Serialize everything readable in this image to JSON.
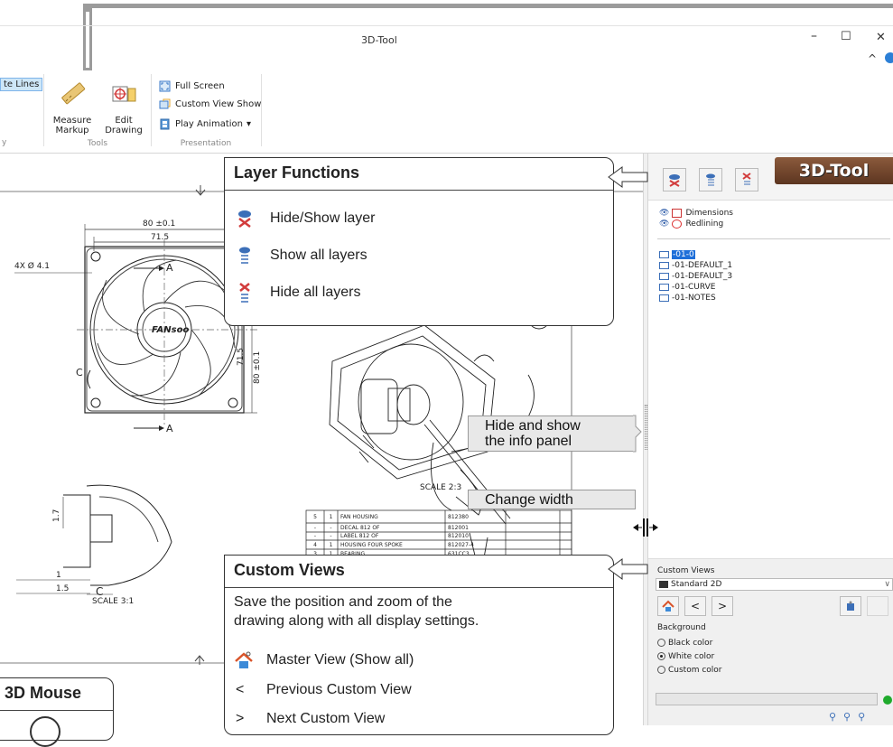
{
  "window": {
    "title": "3D-Tool",
    "minimize": "–",
    "maximize": "☐",
    "close": "✕",
    "collapse": "^"
  },
  "ribbon": {
    "delete_lines": "te Lines",
    "measure_line1": "Measure",
    "measure_line2": "Markup",
    "edit_line1": "Edit",
    "edit_line2": "Drawing",
    "tools_label": "Tools",
    "full_screen": "Full Screen",
    "custom_view_show": "Custom View Show",
    "play_animation": "Play Animation",
    "presentation_label": "Presentation",
    "left_group_fragment": "y"
  },
  "callouts": {
    "layer": {
      "title": "Layer Functions",
      "items": [
        "Hide/Show layer",
        "Show all layers",
        "Hide all layers"
      ]
    },
    "info_panel": "Hide and show the info panel",
    "info_panel_line1": "Hide and show",
    "info_panel_line2": "the info panel",
    "change_width": "Change width",
    "custom_views": {
      "title": "Custom Views",
      "desc_line1": "Save the position and zoom of the",
      "desc_line2": "drawing along with all display settings.",
      "items": [
        "Master View (Show all)",
        "Previous Custom View",
        "Next Custom View"
      ],
      "prefixes": [
        "<",
        ">"
      ]
    },
    "mouse": "3D Mouse"
  },
  "drawing": {
    "dim_80": "80 ±0.1",
    "dim_715": "71.5",
    "holes": "4X Ø 4.1",
    "section_a": "A",
    "side_715": "71.5",
    "side_80": "80 ±0.1",
    "section_c": "C",
    "scale_23": "SCALE 2:3",
    "scale_31": "SCALE 3:1",
    "dim_15": "1.5",
    "dim_1": "1",
    "dim_17": "1.7",
    "brand": "FANsoo",
    "bom": [
      [
        "5",
        "1",
        "FAN HOUSING",
        "812380"
      ],
      [
        "-",
        "-",
        "DECAL 812 OF",
        "812001"
      ],
      [
        "-",
        "-",
        "LABEL 812 OF",
        "812010"
      ],
      [
        "4",
        "1",
        "HOUSING FOUR SPOKE",
        "812027-4"
      ],
      [
        "3",
        "1",
        "BEARING",
        "631CC3"
      ]
    ]
  },
  "panel": {
    "logo": "3D-Tool",
    "layers": [
      "Dimensions",
      "Redlining"
    ],
    "tree": [
      "-01-0",
      "-01-DEFAULT_1",
      "-01-DEFAULT_3",
      "-01-CURVE",
      "-01-NOTES"
    ],
    "custom_views_label": "Custom Views",
    "custom_views_value": "Standard 2D",
    "prev": "<",
    "next": ">",
    "background_label": "Background",
    "bg_options": [
      "Black color",
      "White color",
      "Custom color"
    ],
    "bg_selected": 1
  },
  "colors": {
    "accent": "#1e6fd9",
    "logo_bg": "#7a4a2e",
    "status_green": "#1faa2c"
  }
}
